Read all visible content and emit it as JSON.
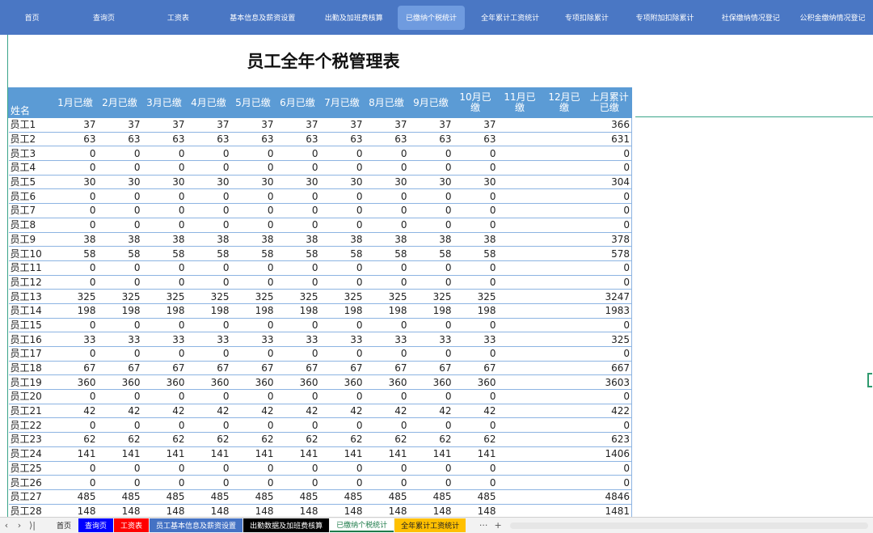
{
  "nav": {
    "items": [
      {
        "label": "首页",
        "active": false
      },
      {
        "label": "查询页",
        "active": false
      },
      {
        "label": "工资表",
        "active": false
      },
      {
        "label": "基本信息及薪资设置",
        "active": false
      },
      {
        "label": "出勤及加班费核算",
        "active": false
      },
      {
        "label": "已缴纳个税统计",
        "active": true
      },
      {
        "label": "全年累计工资统计",
        "active": false
      },
      {
        "label": "专项扣除累计",
        "active": false
      },
      {
        "label": "专项附加扣除累计",
        "active": false
      },
      {
        "label": "社保缴纳情况登记",
        "active": false
      },
      {
        "label": "公积金缴纳情况登记",
        "active": false
      }
    ]
  },
  "sheet": {
    "title": "员工全年个税管理表"
  },
  "table": {
    "headers": [
      "姓名",
      "1月已缴",
      "2月已缴",
      "3月已缴",
      "4月已缴",
      "5月已缴",
      "6月已缴",
      "7月已缴",
      "8月已缴",
      "9月已缴",
      "10月已缴",
      "11月已缴",
      "12月已缴",
      "上月累计已缴"
    ],
    "rows": [
      {
        "name": "员工1",
        "monthly": "37",
        "total": "366"
      },
      {
        "name": "员工2",
        "monthly": "63",
        "total": "631"
      },
      {
        "name": "员工3",
        "monthly": "0",
        "total": "0"
      },
      {
        "name": "员工4",
        "monthly": "0",
        "total": "0"
      },
      {
        "name": "员工5",
        "monthly": "30",
        "total": "304"
      },
      {
        "name": "员工6",
        "monthly": "0",
        "total": "0"
      },
      {
        "name": "员工7",
        "monthly": "0",
        "total": "0"
      },
      {
        "name": "员工8",
        "monthly": "0",
        "total": "0"
      },
      {
        "name": "员工9",
        "monthly": "38",
        "total": "378"
      },
      {
        "name": "员工10",
        "monthly": "58",
        "total": "578"
      },
      {
        "name": "员工11",
        "monthly": "0",
        "total": "0"
      },
      {
        "name": "员工12",
        "monthly": "0",
        "total": "0"
      },
      {
        "name": "员工13",
        "monthly": "325",
        "total": "3247"
      },
      {
        "name": "员工14",
        "monthly": "198",
        "total": "1983"
      },
      {
        "name": "员工15",
        "monthly": "0",
        "total": "0"
      },
      {
        "name": "员工16",
        "monthly": "33",
        "total": "325"
      },
      {
        "name": "员工17",
        "monthly": "0",
        "total": "0"
      },
      {
        "name": "员工18",
        "monthly": "67",
        "total": "667"
      },
      {
        "name": "员工19",
        "monthly": "360",
        "total": "3603"
      },
      {
        "name": "员工20",
        "monthly": "0",
        "total": "0"
      },
      {
        "name": "员工21",
        "monthly": "42",
        "total": "422"
      },
      {
        "name": "员工22",
        "monthly": "0",
        "total": "0"
      },
      {
        "name": "员工23",
        "monthly": "62",
        "total": "623"
      },
      {
        "name": "员工24",
        "monthly": "141",
        "total": "1406"
      },
      {
        "name": "员工25",
        "monthly": "0",
        "total": "0"
      },
      {
        "name": "员工26",
        "monthly": "0",
        "total": "0"
      },
      {
        "name": "员工27",
        "monthly": "485",
        "total": "4846"
      },
      {
        "name": "员工28",
        "monthly": "148",
        "total": "1481"
      }
    ]
  },
  "tabs": {
    "nav_icons": [
      "prev-icon",
      "next-icon",
      "last-icon"
    ],
    "items": [
      {
        "label": "首页",
        "bg": "#f2f2f2",
        "color": "#222222",
        "active": false
      },
      {
        "label": "查询页",
        "bg": "#0000ff",
        "color": "#ffffff",
        "active": false
      },
      {
        "label": "工资表",
        "bg": "#ff0000",
        "color": "#ffffff",
        "active": false
      },
      {
        "label": "员工基本信息及薪资设置",
        "bg": "#4472c4",
        "color": "#ffffff",
        "active": false
      },
      {
        "label": "出勤数据及加班费核算",
        "bg": "#000000",
        "color": "#ffffff",
        "active": false
      },
      {
        "label": "已缴纳个税统计",
        "bg": "#ffffff",
        "color": "#1e7b4a",
        "active": true
      },
      {
        "label": "全年累计工资统计",
        "bg": "#ffc000",
        "color": "#222222",
        "active": false
      }
    ],
    "more": "···",
    "add": "+"
  }
}
